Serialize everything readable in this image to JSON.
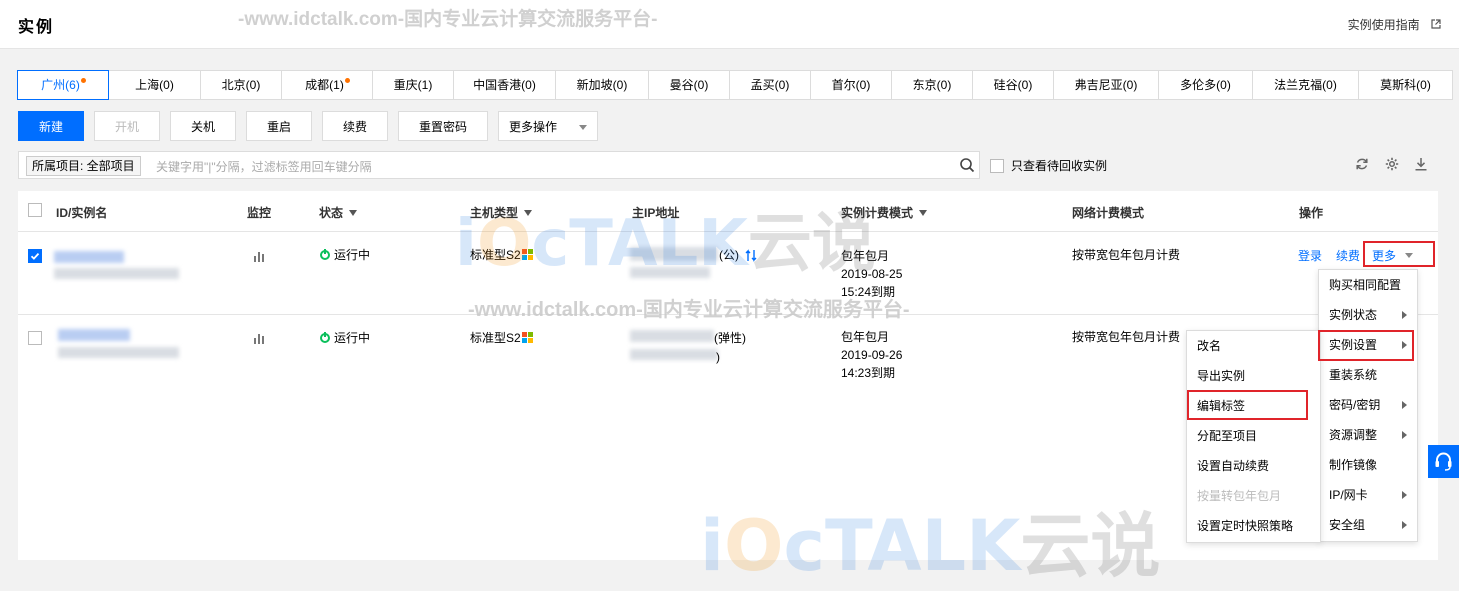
{
  "header": {
    "title": "实例",
    "guide_link": "实例使用指南"
  },
  "watermark": {
    "text": "-www.idctalk.com-国内专业云计算交流服务平台-",
    "logo_word": "TALK",
    "logo_cn": "云说"
  },
  "regions": [
    {
      "label": "广州(6)",
      "active": true,
      "dot": true
    },
    {
      "label": "上海(0)"
    },
    {
      "label": "北京(0)"
    },
    {
      "label": "成都(1)",
      "dot": true
    },
    {
      "label": "重庆(1)"
    },
    {
      "label": "中国香港(0)"
    },
    {
      "label": "新加坡(0)"
    },
    {
      "label": "曼谷(0)"
    },
    {
      "label": "孟买(0)"
    },
    {
      "label": "首尔(0)"
    },
    {
      "label": "东京(0)"
    },
    {
      "label": "硅谷(0)"
    },
    {
      "label": "弗吉尼亚(0)"
    },
    {
      "label": "多伦多(0)"
    },
    {
      "label": "法兰克福(0)"
    },
    {
      "label": "莫斯科(0)"
    }
  ],
  "toolbar": {
    "new": "新建",
    "start": "开机",
    "shutdown": "关机",
    "restart": "重启",
    "renew": "续费",
    "reset_password": "重置密码",
    "more_actions": "更多操作"
  },
  "search": {
    "project_tag": "所属项目: 全部项目",
    "placeholder": "关键字用\"|\"分隔，过滤标签用回车键分隔"
  },
  "recycle_only": "只查看待回收实例",
  "columns": {
    "id": "ID/实例名",
    "monitor": "监控",
    "status": "状态",
    "type": "主机类型",
    "ip": "主IP地址",
    "billing": "实例计费模式",
    "network": "网络计费模式",
    "ops": "操作"
  },
  "rows": [
    {
      "checked": true,
      "status": "运行中",
      "type": "标准型S2",
      "ip_suffix": "(公)",
      "billing": [
        "包年包月",
        "2019-08-25",
        "15:24到期"
      ],
      "network": "按带宽包年包月计费",
      "op_login": "登录",
      "op_renew": "续费",
      "op_more": "更多"
    },
    {
      "checked": false,
      "status": "运行中",
      "type": "标准型S2",
      "ip_suffix": "(弹性)",
      "ip_suffix2": ")",
      "billing": [
        "包年包月",
        "2019-09-26",
        "14:23到期"
      ],
      "network": "按带宽包年包月计费"
    }
  ],
  "more_menu": [
    {
      "label": "购买相同配置",
      "arrow": false
    },
    {
      "label": "实例状态",
      "arrow": true
    },
    {
      "label": "实例设置",
      "arrow": true
    },
    {
      "label": "重装系统",
      "arrow": false
    },
    {
      "label": "密码/密钥",
      "arrow": true
    },
    {
      "label": "资源调整",
      "arrow": true
    },
    {
      "label": "制作镜像",
      "arrow": false
    },
    {
      "label": "IP/网卡",
      "arrow": true
    },
    {
      "label": "安全组",
      "arrow": true
    }
  ],
  "settings_submenu": [
    {
      "label": "改名"
    },
    {
      "label": "导出实例"
    },
    {
      "label": "编辑标签"
    },
    {
      "label": "分配至项目"
    },
    {
      "label": "设置自动续费"
    },
    {
      "label": "按量转包年包月",
      "disabled": true
    },
    {
      "label": "设置定时快照策略"
    }
  ],
  "colors": {
    "primary": "#006eff",
    "running": "#0abf5b",
    "highlight": "#e0242a",
    "region_dot": "#ff7200"
  }
}
